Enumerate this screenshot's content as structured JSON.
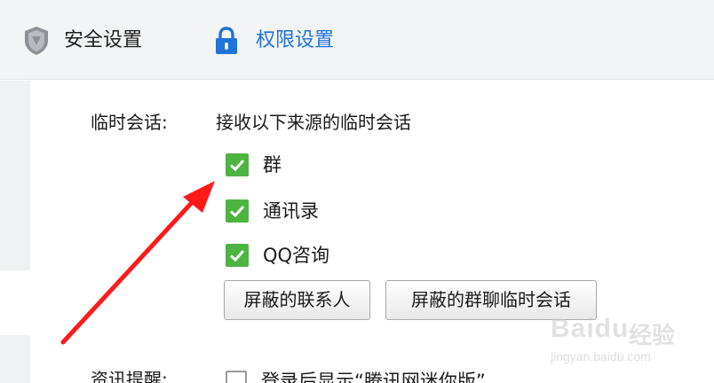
{
  "tabs": {
    "security": {
      "label": "安全设置",
      "icon": "shield-icon"
    },
    "permission": {
      "label": "权限设置",
      "icon": "lock-icon",
      "color": "#1e74d8"
    }
  },
  "temp_session": {
    "label": "临时会话:",
    "headline": "接收以下来源的临时会话",
    "options": [
      {
        "label": "群",
        "checked": true
      },
      {
        "label": "通讯录",
        "checked": true
      },
      {
        "label": "QQ咨询",
        "checked": true
      }
    ],
    "buttons": {
      "blocked_contacts": "屏蔽的联系人",
      "blocked_group_sessions": "屏蔽的群聊临时会话"
    }
  },
  "news_reminder": {
    "label": "资讯提醒:",
    "option": {
      "label": "登录后显示“腾讯网迷你版”",
      "checked": false
    }
  },
  "colors": {
    "check_green": "#4cb43f",
    "annotation_arrow": "#ff1a1a"
  },
  "watermark": {
    "logo": "Baidu",
    "brand": "经验",
    "url": "jingyan.baidu.com"
  }
}
